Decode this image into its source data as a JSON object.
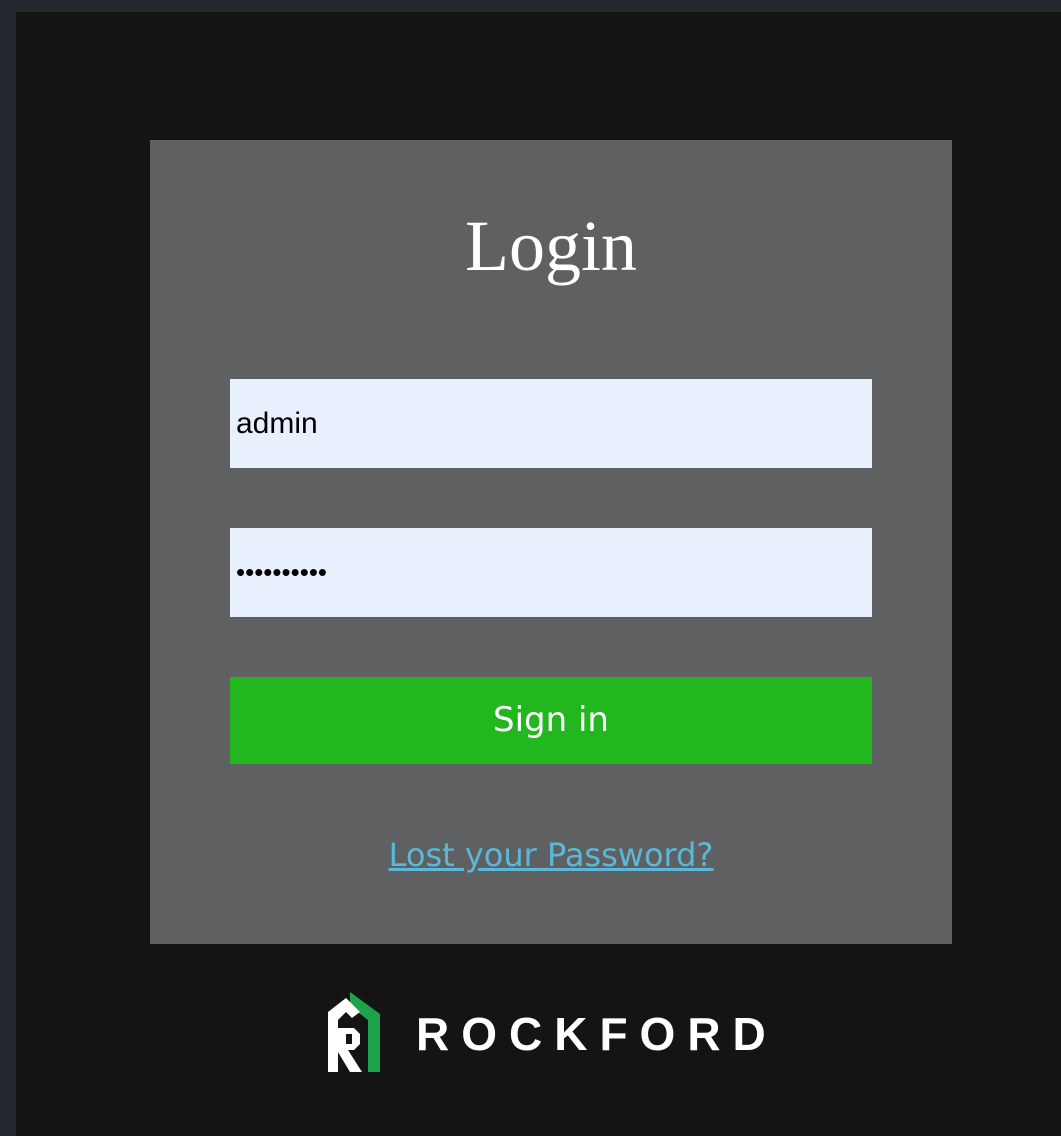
{
  "login": {
    "title": "Login",
    "username_value": "admin",
    "password_value": "••••••••••",
    "signin_label": "Sign in",
    "lost_password_label": "Lost your Password?"
  },
  "brand": {
    "name": "ROCKFORD",
    "logo_icon": "rockford-logo-icon"
  },
  "colors": {
    "page_frame": "#23272e",
    "background": "#141414",
    "card": "#5f6061",
    "input_background": "#e8effd",
    "signin_button": "#22b71f",
    "link": "#5ab8d8",
    "logo_green": "#1fa34a"
  }
}
